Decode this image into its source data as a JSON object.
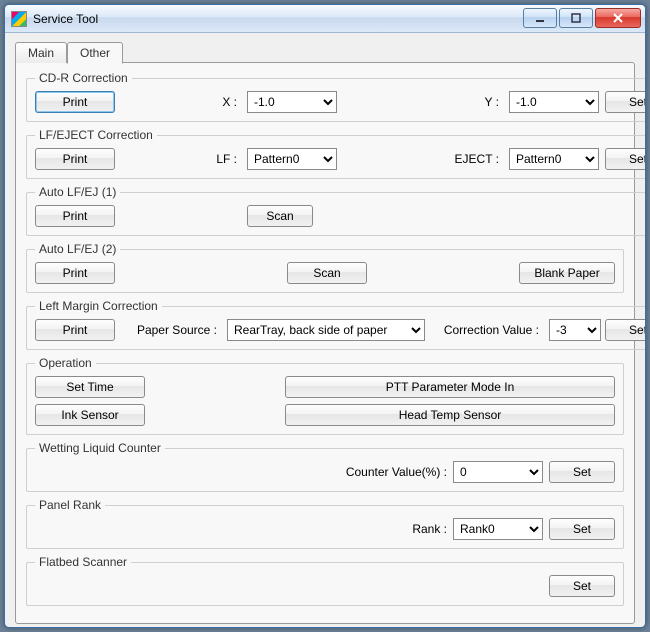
{
  "window": {
    "title": "Service Tool"
  },
  "tabs": {
    "main": "Main",
    "other": "Other",
    "active": "other"
  },
  "groups": {
    "cdr": {
      "legend": "CD-R Correction",
      "print": "Print",
      "x_label": "X :",
      "x_value": "-1.0",
      "y_label": "Y :",
      "y_value": "-1.0",
      "set": "Set"
    },
    "lfej": {
      "legend": "LF/EJECT Correction",
      "print": "Print",
      "lf_label": "LF :",
      "lf_value": "Pattern0",
      "eject_label": "EJECT :",
      "eject_value": "Pattern0",
      "set": "Set"
    },
    "auto1": {
      "legend": "Auto LF/EJ (1)",
      "print": "Print",
      "scan": "Scan"
    },
    "auto2": {
      "legend": "Auto LF/EJ (2)",
      "print": "Print",
      "scan": "Scan",
      "blank": "Blank Paper"
    },
    "lmc": {
      "legend": "Left Margin Correction",
      "print": "Print",
      "source_label": "Paper Source :",
      "source_value": "RearTray, back side of paper",
      "cv_label": "Correction Value :",
      "cv_value": "-3",
      "set": "Set"
    },
    "op": {
      "legend": "Operation",
      "set_time": "Set Time",
      "ink_sensor": "Ink Sensor",
      "ptt": "PTT Parameter Mode In",
      "head_temp": "Head Temp Sensor"
    },
    "wlc": {
      "legend": "Wetting Liquid Counter",
      "label": "Counter Value(%) :",
      "value": "0",
      "set": "Set"
    },
    "rank": {
      "legend": "Panel Rank",
      "label": "Rank :",
      "value": "Rank0",
      "set": "Set"
    },
    "flatbed": {
      "legend": "Flatbed Scanner",
      "set": "Set"
    }
  },
  "window_controls": {
    "minimize": "minimize",
    "maximize": "maximize",
    "close": "close"
  }
}
